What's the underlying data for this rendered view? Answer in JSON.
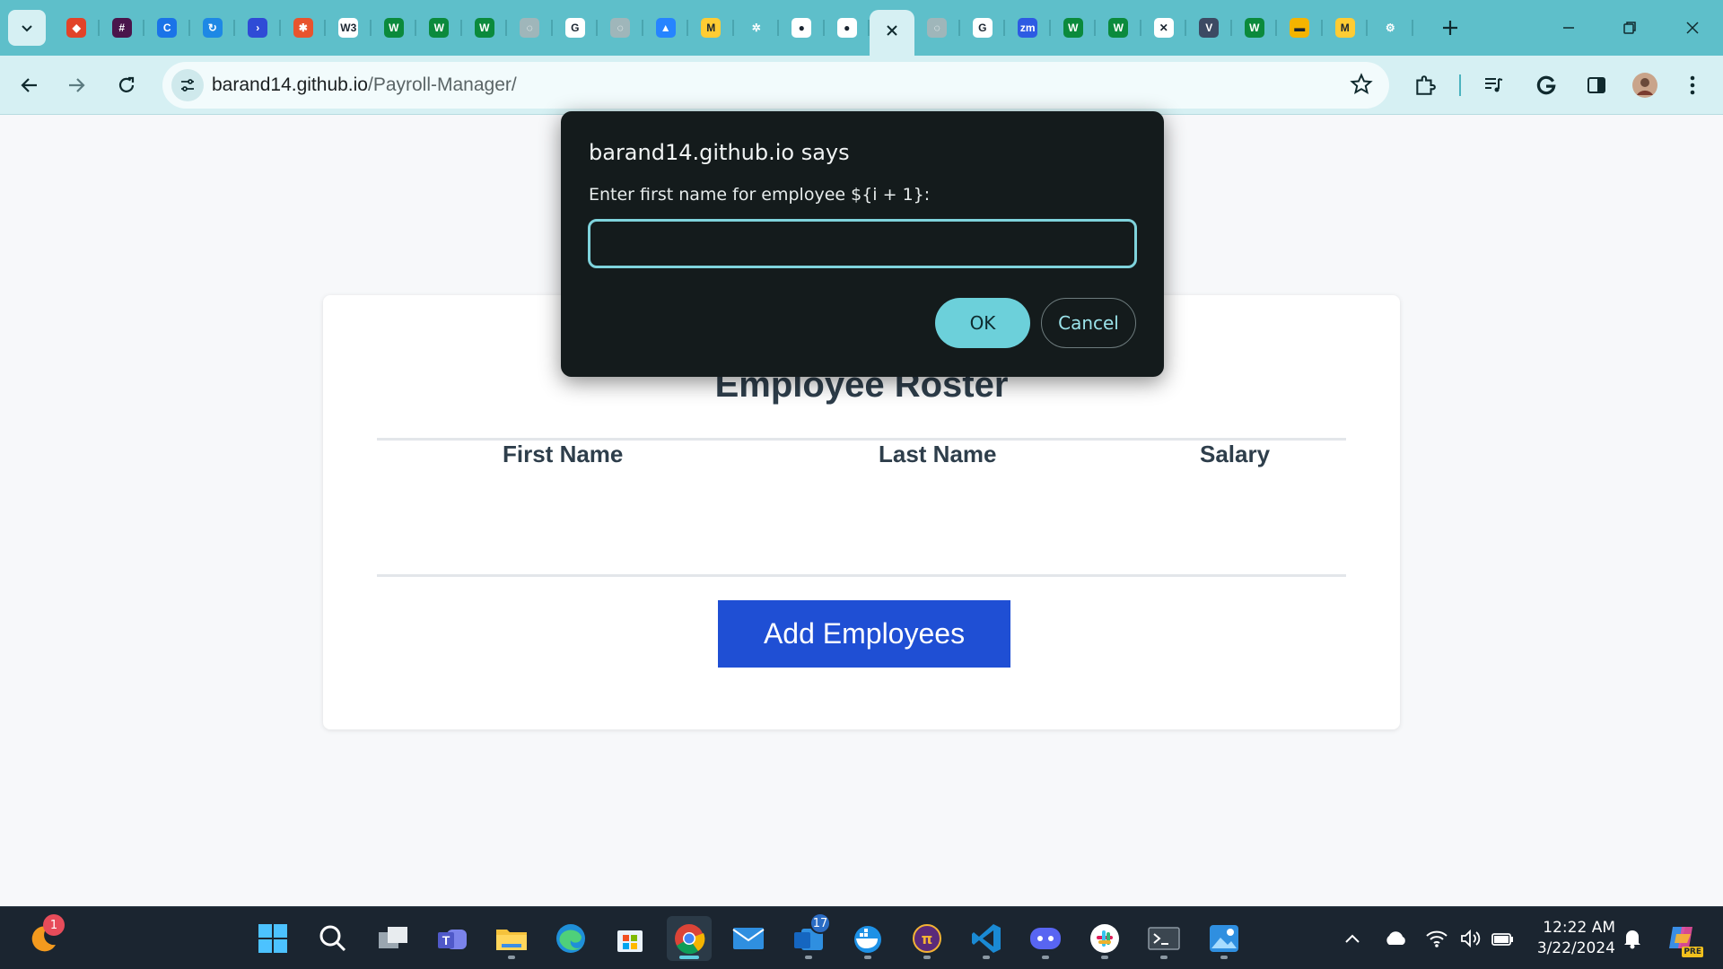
{
  "browser": {
    "tabs": [
      {
        "icon": "gitlab-icon",
        "color": "#e24329",
        "glyph": "◆"
      },
      {
        "icon": "slack-icon",
        "color": "#4a154b",
        "glyph": "#"
      },
      {
        "icon": "circle-c-icon",
        "color": "#1a73e8",
        "glyph": "C"
      },
      {
        "icon": "refresh-app-icon",
        "color": "#1e88e5",
        "glyph": "↻"
      },
      {
        "icon": "power-automate-icon",
        "color": "#2f4bd6",
        "glyph": "›"
      },
      {
        "icon": "asterisk-icon",
        "color": "#e8542e",
        "glyph": "✱"
      },
      {
        "icon": "w3schools-icon",
        "color": "#ffffff",
        "glyph": "W3"
      },
      {
        "icon": "w-site-icon",
        "color": "#0b8a3c",
        "glyph": "W"
      },
      {
        "icon": "w-site-icon",
        "color": "#0b8a3c",
        "glyph": "W"
      },
      {
        "icon": "w-site-icon",
        "color": "#0b8a3c",
        "glyph": "W"
      },
      {
        "icon": "loading-icon",
        "color": "#9fb6ba",
        "glyph": "◌"
      },
      {
        "icon": "google-icon",
        "color": "#ffffff",
        "glyph": "G"
      },
      {
        "icon": "loading-icon",
        "color": "#9fb6ba",
        "glyph": "◌"
      },
      {
        "icon": "atlassian-icon",
        "color": "#2684ff",
        "glyph": "▲"
      },
      {
        "icon": "umn-icon",
        "color": "#ffcc33",
        "glyph": "M"
      },
      {
        "icon": "openai-icon",
        "color": "#5ebfca",
        "glyph": "✲"
      },
      {
        "icon": "github-icon",
        "color": "#ffffff",
        "glyph": "●"
      },
      {
        "icon": "github-icon",
        "color": "#ffffff",
        "glyph": "●"
      }
    ],
    "tabs_after_active": [
      {
        "icon": "loading-icon",
        "color": "#9fb6ba",
        "glyph": "◌"
      },
      {
        "icon": "google-icon",
        "color": "#ffffff",
        "glyph": "G"
      },
      {
        "icon": "zoom-icon",
        "color": "#2d5be3",
        "glyph": "zm"
      },
      {
        "icon": "w-site-icon",
        "color": "#0b8a3c",
        "glyph": "W"
      },
      {
        "icon": "w-site-icon",
        "color": "#0b8a3c",
        "glyph": "W"
      },
      {
        "icon": "xmark-app-icon",
        "color": "#ffffff",
        "glyph": "✕"
      },
      {
        "icon": "vaio-icon",
        "color": "#3c4a63",
        "glyph": "V"
      },
      {
        "icon": "w-site-icon",
        "color": "#0b8a3c",
        "glyph": "W"
      },
      {
        "icon": "slides-icon",
        "color": "#f4b400",
        "glyph": "▬"
      },
      {
        "icon": "umn-icon",
        "color": "#ffcc33",
        "glyph": "M"
      },
      {
        "icon": "settings-icon",
        "color": "#5ebfca",
        "glyph": "⚙"
      }
    ],
    "url_host": "barand14.github.io",
    "url_path": "/Payroll-Manager/"
  },
  "page": {
    "roster_title": "Employee Roster",
    "columns": [
      "First Name",
      "Last Name",
      "Salary"
    ],
    "add_button_label": "Add Employees"
  },
  "dialog": {
    "title": "barand14.github.io says",
    "message": "Enter first name for employee ${i + 1}:",
    "input_value": "",
    "ok_label": "OK",
    "cancel_label": "Cancel"
  },
  "taskbar": {
    "notification_badge": "1",
    "mail_badge": "17",
    "time": "12:22 AM",
    "date": "3/22/2024",
    "copilot_label": "PRE"
  },
  "colors": {
    "tab_strip": "#5ebfca",
    "toolbar": "#d6f0f3",
    "add_button": "#1f4fd4",
    "dialog_bg": "#141b1c",
    "dialog_accent": "#6cd0da"
  }
}
